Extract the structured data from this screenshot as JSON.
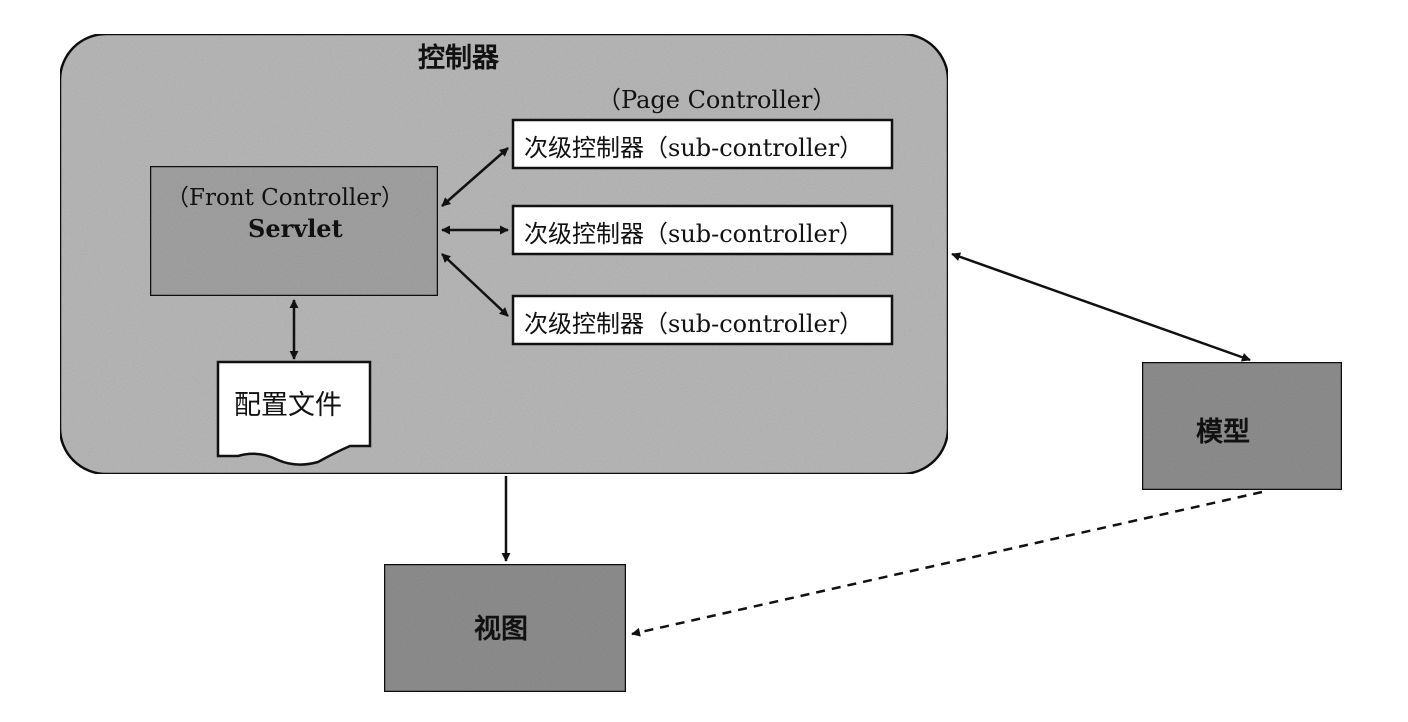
{
  "controller": {
    "title": "控制器"
  },
  "page_controller": {
    "title": "（Page Controller）"
  },
  "front_controller": {
    "title": "（Front Controller）",
    "name": "Servlet"
  },
  "sub_controllers": [
    {
      "label": "次级控制器（sub-controller）"
    },
    {
      "label": "次级控制器（sub-controller）"
    },
    {
      "label": "次级控制器（sub-controller）"
    }
  ],
  "config_file": {
    "label": "配置文件"
  },
  "model": {
    "label": "模型"
  },
  "view": {
    "label": "视图"
  },
  "colors": {
    "controller_fill": "#b9b9b9",
    "dark_box_fill": "#8f8f8f",
    "front_controller_fill": "#a3a3a3",
    "line": "#111111",
    "white": "#ffffff"
  }
}
